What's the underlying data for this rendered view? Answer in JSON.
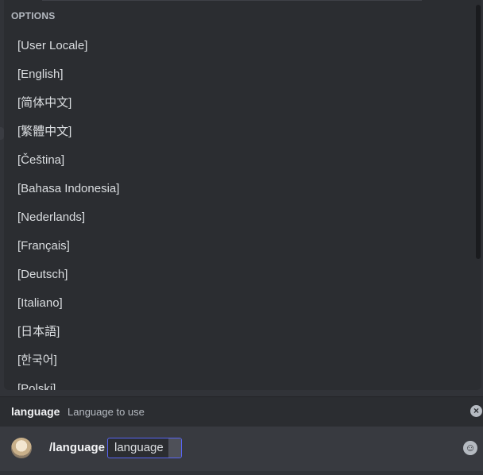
{
  "popup": {
    "header": "OPTIONS",
    "options": [
      "[User Locale]",
      "[English]",
      "[简体中文]",
      "[繁體中文]",
      "[Čeština]",
      "[Bahasa Indonesia]",
      "[Nederlands]",
      "[Français]",
      "[Deutsch]",
      "[Italiano]",
      "[日本語]",
      "[한국어]",
      "[Polski]"
    ]
  },
  "parameter": {
    "name": "language",
    "description": "Language to use",
    "close_icon": "close-circle-icon"
  },
  "composer": {
    "command": "/language",
    "option_chip": "language",
    "emoji_icon": "emoji-smile-icon"
  },
  "colors": {
    "accent": "#5865f2",
    "background": "#313338",
    "popup": "#2b2d31"
  }
}
